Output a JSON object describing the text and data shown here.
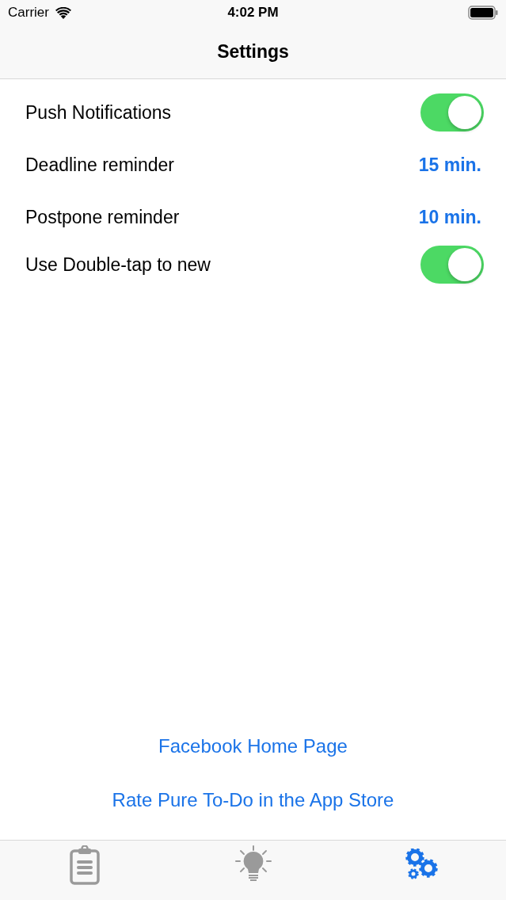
{
  "status_bar": {
    "carrier": "Carrier",
    "time": "4:02 PM"
  },
  "nav": {
    "title": "Settings"
  },
  "settings": [
    {
      "kind": "toggle",
      "label": "Push Notifications",
      "on": true
    },
    {
      "kind": "value",
      "label": "Deadline reminder",
      "value": "15 min."
    },
    {
      "kind": "value",
      "label": "Postpone reminder",
      "value": "10 min."
    },
    {
      "kind": "toggle",
      "label": "Use Double-tap to new",
      "on": true
    }
  ],
  "links": [
    "Facebook Home Page",
    "Rate Pure To-Do in the App Store"
  ],
  "tabs": [
    {
      "kind": "clipboard",
      "selected": false
    },
    {
      "kind": "bulb",
      "selected": false
    },
    {
      "kind": "gears",
      "selected": true
    }
  ]
}
